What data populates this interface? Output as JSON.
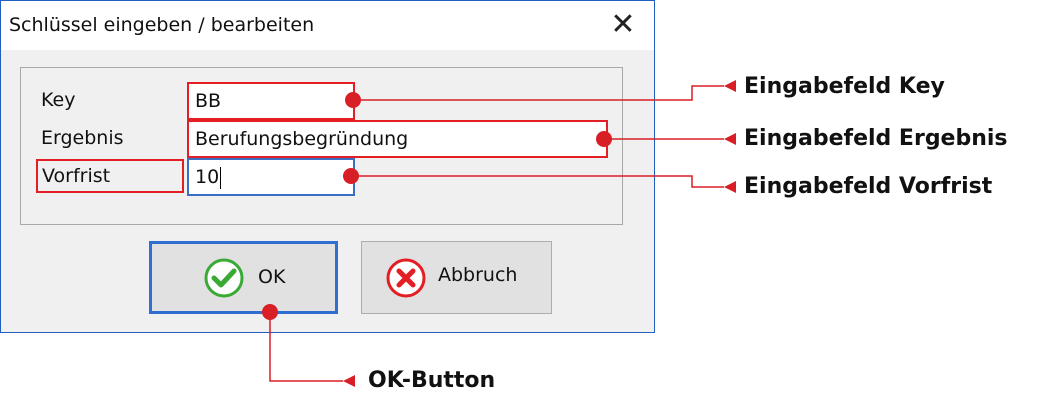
{
  "window": {
    "title": "Schlüssel eingeben / bearbeiten",
    "close_symbol": "✕"
  },
  "form": {
    "key_label": "Key",
    "key_value": "BB",
    "result_label": "Ergebnis",
    "result_value": "Berufungsbegründung",
    "deadline_label": "Vorfrist",
    "deadline_value": "10"
  },
  "buttons": {
    "ok_label": "OK",
    "cancel_label": "Abbruch"
  },
  "callouts": {
    "key": "Eingabefeld Key",
    "result": "Eingabefeld Ergebnis",
    "deadline": "Eingabefeld Vorfrist",
    "ok": "OK-Button"
  },
  "colors": {
    "annotation_red": "#d81f26",
    "ok_green": "#3aaa35",
    "cancel_red": "#e31e24",
    "focus_blue": "#2f6fd0"
  }
}
